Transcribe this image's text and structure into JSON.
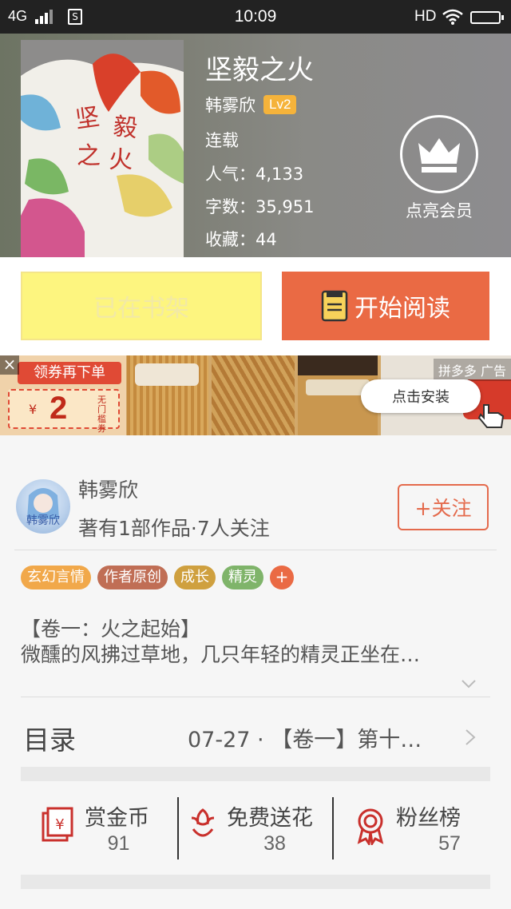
{
  "status_bar": {
    "network": "4G",
    "time": "10:09",
    "hd": "HD"
  },
  "book": {
    "title": "坚毅之火",
    "cover_text": "坚毅之火",
    "author": "韩雾欣",
    "level": "Lv2",
    "status": "连载",
    "popularity": "人气：4,133",
    "word_count": "字数：35,951",
    "favorites": "收藏：44"
  },
  "vip": {
    "label": "点亮会员"
  },
  "actions": {
    "shelf_label": "已在书架",
    "read_label": "开始阅读"
  },
  "ad": {
    "coupon_text": "领券再下单",
    "coupon_amount": "2",
    "coupon_currency": "¥",
    "coupon_note": "无门槛券",
    "sponsor": "拼多多 广告",
    "install_label": "点击安装",
    "close": "×"
  },
  "author_card": {
    "avatar_text": "韩雾欣",
    "name": "韩雾欣",
    "works": "著有1部作品·7人关注",
    "follow_label": "+关注"
  },
  "tags": [
    {
      "label": "玄幻言情",
      "color": "#f1a84a"
    },
    {
      "label": "作者原创",
      "color": "#c06e55"
    },
    {
      "label": "成长",
      "color": "#cfa03f"
    },
    {
      "label": "精灵",
      "color": "#7fb46a"
    }
  ],
  "tag_more": "+",
  "excerpt": {
    "line1": "【卷一：火之起始】",
    "line2": "微醺的风拂过草地，几只年轻的精灵正坐在…"
  },
  "toc": {
    "title": "目录",
    "latest": "07-27 · 【卷一】第十…"
  },
  "stats": [
    {
      "label": "赏金币",
      "value": "91",
      "icon": "red-envelope-icon"
    },
    {
      "label": "免费送花",
      "value": "38",
      "icon": "flower-icon"
    },
    {
      "label": "粉丝榜",
      "value": "57",
      "icon": "medal-icon"
    }
  ],
  "colors": {
    "accent": "#ea6a44",
    "shelf": "#fdf57f",
    "lv": "#f5b33b"
  }
}
